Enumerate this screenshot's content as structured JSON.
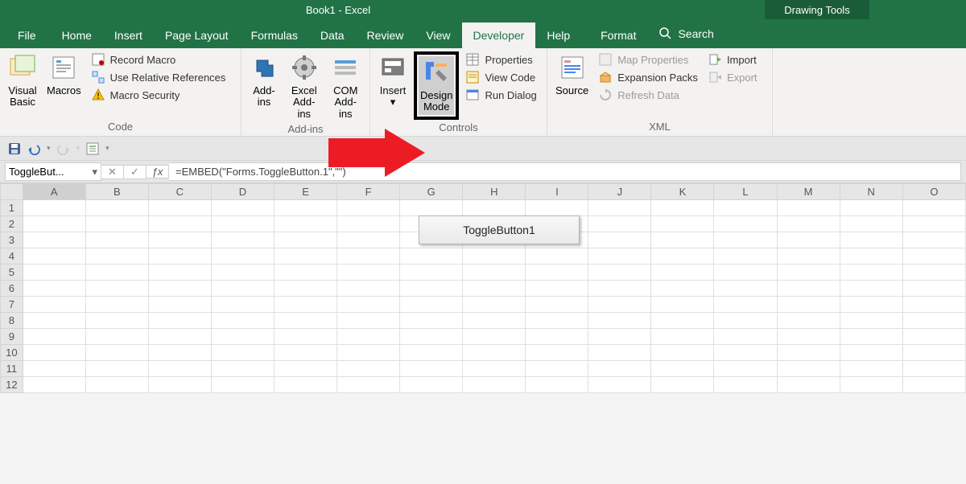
{
  "titlebar": {
    "title": "Book1  -  Excel",
    "contextual": "Drawing Tools"
  },
  "tabs": {
    "file": "File",
    "home": "Home",
    "insert": "Insert",
    "pagelayout": "Page Layout",
    "formulas": "Formulas",
    "data": "Data",
    "review": "Review",
    "view": "View",
    "developer": "Developer",
    "help": "Help",
    "format": "Format",
    "search": "Search"
  },
  "ribbon": {
    "code": {
      "visual_basic": "Visual\nBasic",
      "macros": "Macros",
      "record_macro": "Record Macro",
      "use_relative": "Use Relative References",
      "macro_security": "Macro Security",
      "group": "Code"
    },
    "addins": {
      "addins_btn": "Add-\nins",
      "excel_addins": "Excel\nAdd-ins",
      "com_addins": "COM\nAdd-ins",
      "group": "Add-ins"
    },
    "controls": {
      "insert": "Insert",
      "design_mode": "Design\nMode",
      "properties": "Properties",
      "view_code": "View Code",
      "run_dialog": "Run Dialog",
      "group": "Controls"
    },
    "xml": {
      "source": "Source",
      "map_properties": "Map Properties",
      "expansion_packs": "Expansion Packs",
      "refresh_data": "Refresh Data",
      "import": "Import",
      "export": "Export",
      "group": "XML"
    }
  },
  "formula_bar": {
    "namebox": "ToggleBut...",
    "formula": "=EMBED(\"Forms.ToggleButton.1\",\"\")"
  },
  "grid": {
    "columns": [
      "A",
      "B",
      "C",
      "D",
      "E",
      "F",
      "G",
      "H",
      "I",
      "J",
      "K",
      "L",
      "M",
      "N",
      "O"
    ],
    "rows": [
      "1",
      "2",
      "3",
      "4",
      "5",
      "6",
      "7",
      "8",
      "9",
      "10",
      "11",
      "12"
    ]
  },
  "sheet_object": {
    "toggle_caption": "ToggleButton1"
  }
}
